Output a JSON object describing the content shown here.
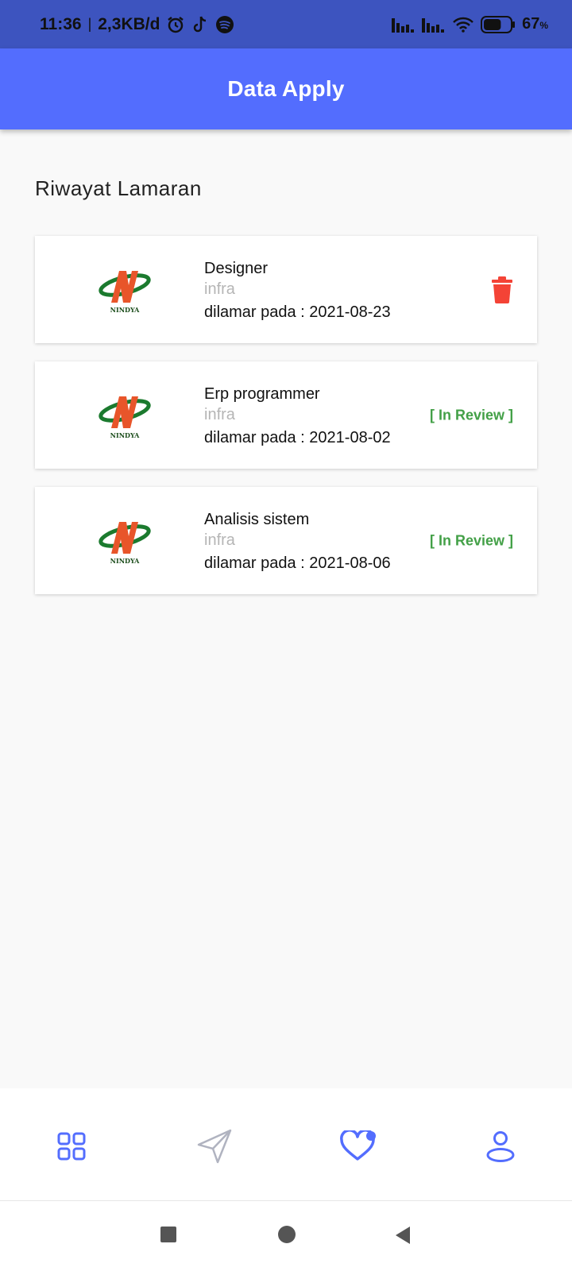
{
  "status_bar": {
    "time": "11:36",
    "separator": "|",
    "data_speed": "2,3KB/d",
    "battery_percent": "67",
    "battery_unit": "%",
    "battery_level": 0.67
  },
  "app_bar": {
    "title": "Data Apply"
  },
  "section": {
    "title": "Riwayat Lamaran"
  },
  "applications": [
    {
      "logo_text": "NINDYA",
      "title": "Designer",
      "company": "infra",
      "applied_label": "dilamar pada : 2021-08-23",
      "action": "delete-icon"
    },
    {
      "logo_text": "NINDYA",
      "title": "Erp programmer",
      "company": "infra",
      "applied_label": "dilamar pada : 2021-08-02",
      "status": "[ In Review ]"
    },
    {
      "logo_text": "NINDYA",
      "title": "Analisis sistem",
      "company": "infra",
      "applied_label": "dilamar pada : 2021-08-06",
      "status": "[ In Review ]"
    }
  ],
  "bottom_nav": [
    {
      "icon": "grid-icon"
    },
    {
      "icon": "send-icon"
    },
    {
      "icon": "heart-icon",
      "active": true
    },
    {
      "icon": "user-icon"
    }
  ],
  "colors": {
    "status_bar": "#3d54bf",
    "app_bar": "#536dfe",
    "in_review": "#43a047",
    "delete": "#f44336",
    "nav_active": "#536dfe",
    "nav_inactive": "#b0b3c0"
  }
}
